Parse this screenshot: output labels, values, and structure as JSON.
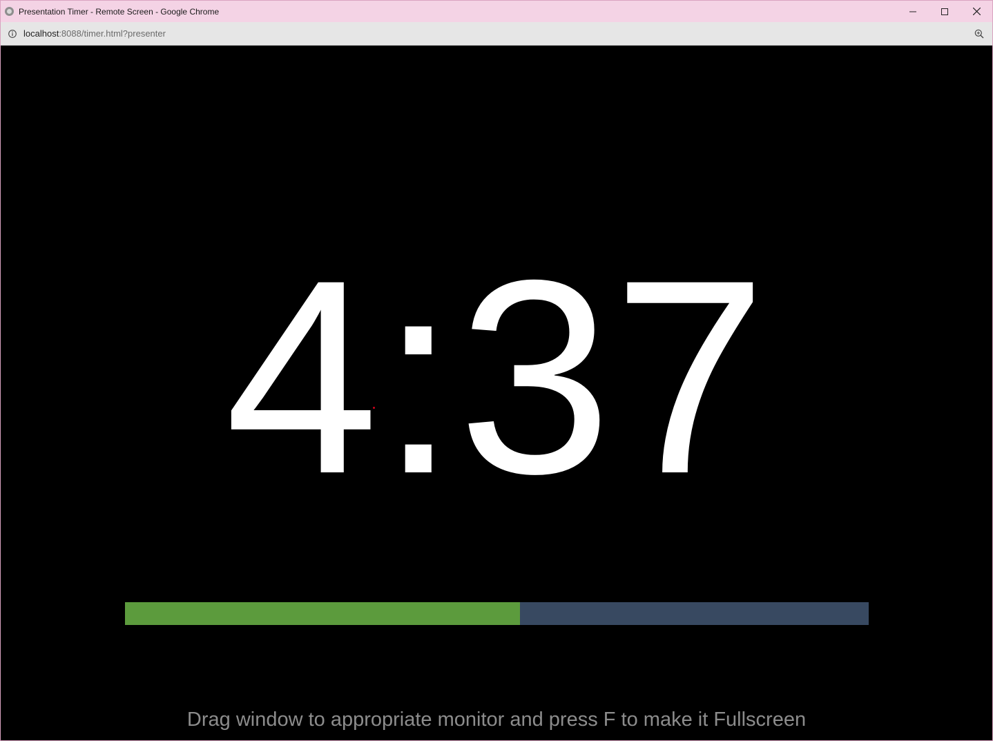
{
  "window": {
    "title": "Presentation Timer - Remote Screen - Google Chrome"
  },
  "address_bar": {
    "host": "localhost",
    "path": ":8088/timer.html?presenter"
  },
  "timer": {
    "display": "4:37",
    "progress_fraction": 0.531,
    "progress_color": "#5c9b3d",
    "track_color": "#384961"
  },
  "hint": {
    "text": "Drag window to appropriate monitor and press F to make it Fullscreen"
  },
  "icons": {
    "favicon": "chrome-page-icon",
    "info": "info-icon",
    "zoom": "zoom-icon",
    "minimize": "minimize-icon",
    "maximize": "maximize-icon",
    "close": "close-icon"
  }
}
